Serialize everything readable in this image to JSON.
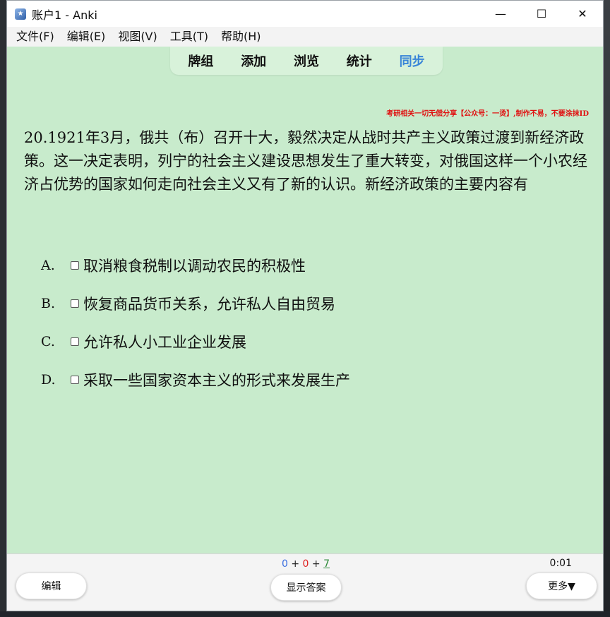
{
  "window": {
    "title": "账户1 - Anki",
    "app_icon": "anki-star-icon"
  },
  "window_controls": {
    "minimize": "—",
    "maximize": "☐",
    "close": "✕"
  },
  "menu": [
    "文件(F)",
    "编辑(E)",
    "视图(V)",
    "工具(T)",
    "帮助(H)"
  ],
  "nav": {
    "items": [
      "牌组",
      "添加",
      "浏览",
      "统计",
      "同步"
    ],
    "active_index": 4,
    "active_color": "#3a86d8"
  },
  "card": {
    "notice": "考研相关一切无偿分享【公众号：一烫】,制作不易，不要涂抹ID",
    "question": "20.1921年3月，俄共（布）召开十大，毅然决定从战时共产主义政策过渡到新经济政策。这一决定表明，列宁的社会主义建设思想发生了重大转变，对俄国这样一个小农经济占优势的国家如何走向社会主义又有了新的认识。新经济政策的主要内容有",
    "options": [
      {
        "letter": "A.",
        "text": "取消粮食税制以调动农民的积极性"
      },
      {
        "letter": "B.",
        "text": "恢复商品货币关系，允许私人自由贸易"
      },
      {
        "letter": "C.",
        "text": "允许私人小工业企业发展"
      },
      {
        "letter": "D.",
        "text": "采取一些国家资本主义的形式来发展生产"
      }
    ],
    "background_color": "#c8ebcc"
  },
  "bottom": {
    "counts": {
      "new": "0",
      "learn": "0",
      "review": "7",
      "sep": "+"
    },
    "timer": "0:01",
    "edit_label": "编辑",
    "show_answer_label": "显示答案",
    "more_label": "更多▼"
  }
}
